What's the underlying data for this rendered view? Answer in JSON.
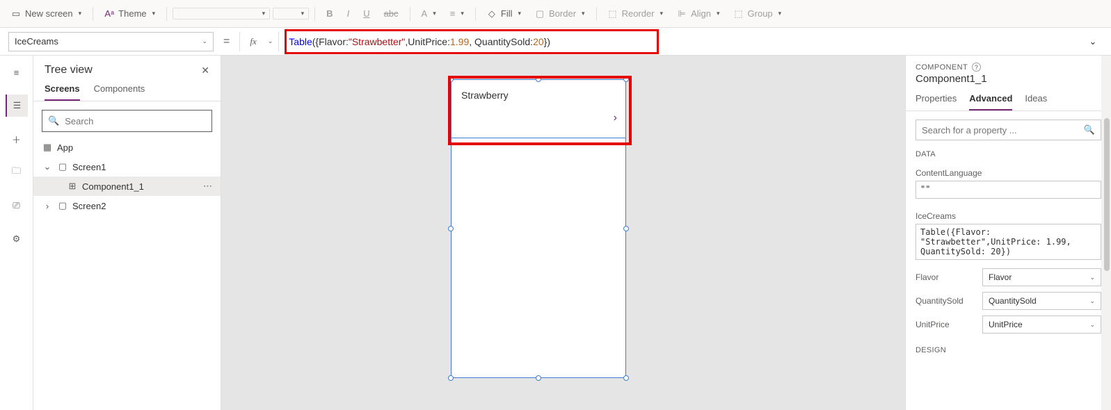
{
  "toolbar": {
    "new_screen": "New screen",
    "theme": "Theme",
    "fill": "Fill",
    "border": "Border",
    "reorder": "Reorder",
    "align": "Align",
    "group": "Group"
  },
  "formula_bar": {
    "property": "IceCreams",
    "fx": "fx",
    "tok_fn": "Table",
    "tok_open": "({Flavor: ",
    "tok_str": "\"Strawbetter\"",
    "tok_mid": ",UnitPrice: ",
    "tok_num1": "1.99",
    "tok_mid2": ", QuantitySold: ",
    "tok_num2": "20",
    "tok_close": "})"
  },
  "tree": {
    "title": "Tree view",
    "tabs": {
      "screens": "Screens",
      "components": "Components"
    },
    "search_placeholder": "Search",
    "items": {
      "app": "App",
      "screen1": "Screen1",
      "component1_1": "Component1_1",
      "screen2": "Screen2"
    }
  },
  "canvas": {
    "gallery_text": "Strawberry"
  },
  "right": {
    "header": "COMPONENT",
    "title": "Component1_1",
    "tabs": {
      "properties": "Properties",
      "advanced": "Advanced",
      "ideas": "Ideas"
    },
    "search_placeholder": "Search for a property ...",
    "sect_data": "DATA",
    "content_language_label": "ContentLanguage",
    "content_language_value": "\"\"",
    "icecreams_label": "IceCreams",
    "icecreams_value": "Table({Flavor: \"Strawbetter\",UnitPrice: 1.99, QuantitySold: 20})",
    "flavor_label": "Flavor",
    "flavor_value": "Flavor",
    "quantity_label": "QuantitySold",
    "quantity_value": "QuantitySold",
    "unitprice_label": "UnitPrice",
    "unitprice_value": "UnitPrice",
    "sect_design": "DESIGN"
  }
}
